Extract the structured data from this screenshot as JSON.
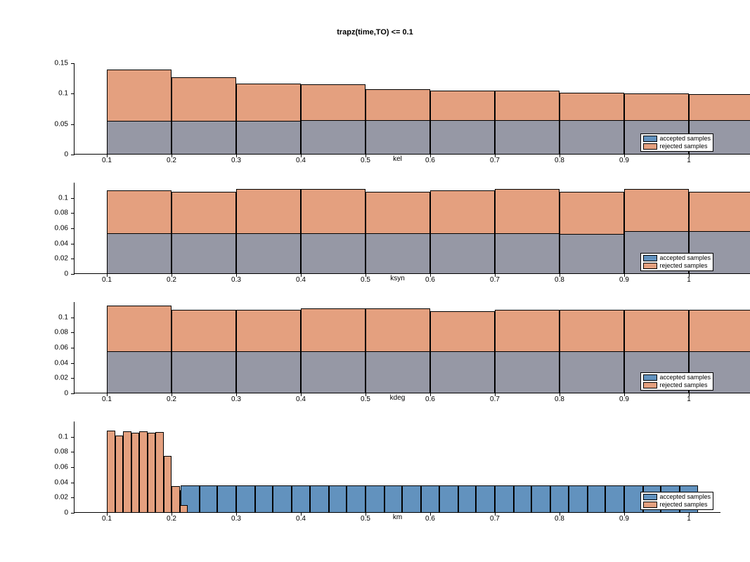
{
  "title": "trapz(time,TO) <= 0.1",
  "legend": {
    "accepted": "accepted samples",
    "rejected": "rejected samples"
  },
  "xticks": [
    0.1,
    0.2,
    0.3,
    0.4,
    0.5,
    0.6,
    0.7,
    0.8,
    0.9,
    1
  ],
  "panels": {
    "kel": {
      "xlabel": "kel",
      "ymax": 0.15,
      "yticks": [
        0,
        0.05,
        0.1,
        0.15
      ]
    },
    "ksyn": {
      "xlabel": "ksyn",
      "ymax": 0.12,
      "yticks": [
        0,
        0.02,
        0.04,
        0.06,
        0.08,
        0.1
      ]
    },
    "kdeg": {
      "xlabel": "kdeg",
      "ymax": 0.12,
      "yticks": [
        0,
        0.02,
        0.04,
        0.06,
        0.08,
        0.1
      ]
    },
    "km": {
      "xlabel": "km",
      "ymax": 0.12,
      "yticks": [
        0,
        0.02,
        0.04,
        0.06,
        0.08,
        0.1
      ]
    }
  },
  "chart_data": [
    {
      "type": "bar",
      "param": "kel",
      "title": "trapz(time,TO) <= 0.1",
      "xlabel": "kel",
      "ylabel": "",
      "ylim": [
        0,
        0.15
      ],
      "bin_edges": [
        0.1,
        0.2,
        0.3,
        0.4,
        0.5,
        0.6,
        0.7,
        0.8,
        0.9,
        1.0
      ],
      "series": [
        {
          "name": "accepted samples",
          "values": [
            0.14,
            0.127,
            0.117,
            0.115,
            0.107,
            0.105,
            0.105,
            0.102,
            0.1,
            0.099
          ]
        },
        {
          "name": "rejected samples",
          "values": [
            0.055,
            0.055,
            0.055,
            0.056,
            0.057,
            0.057,
            0.057,
            0.056,
            0.056,
            0.056
          ]
        }
      ]
    },
    {
      "type": "bar",
      "param": "ksyn",
      "xlabel": "ksyn",
      "ylim": [
        0,
        0.12
      ],
      "bin_edges": [
        0.1,
        0.2,
        0.3,
        0.4,
        0.5,
        0.6,
        0.7,
        0.8,
        0.9,
        1.0
      ],
      "series": [
        {
          "name": "accepted samples",
          "values": [
            0.11,
            0.108,
            0.112,
            0.112,
            0.108,
            0.11,
            0.112,
            0.108,
            0.112,
            0.108
          ]
        },
        {
          "name": "rejected samples",
          "values": [
            0.054,
            0.054,
            0.054,
            0.054,
            0.054,
            0.054,
            0.054,
            0.053,
            0.056,
            0.056
          ]
        }
      ]
    },
    {
      "type": "bar",
      "param": "kdeg",
      "xlabel": "kdeg",
      "ylim": [
        0,
        0.12
      ],
      "bin_edges": [
        0.1,
        0.2,
        0.3,
        0.4,
        0.5,
        0.6,
        0.7,
        0.8,
        0.9,
        1.0
      ],
      "series": [
        {
          "name": "accepted samples",
          "values": [
            0.115,
            0.11,
            0.11,
            0.112,
            0.112,
            0.108,
            0.11,
            0.11,
            0.11,
            0.11
          ]
        },
        {
          "name": "rejected samples",
          "values": [
            0.055,
            0.055,
            0.055,
            0.055,
            0.055,
            0.055,
            0.055,
            0.055,
            0.055,
            0.055
          ]
        }
      ]
    },
    {
      "type": "bar",
      "param": "km",
      "xlabel": "km",
      "ylim": [
        0,
        0.12
      ],
      "bin_edges_accepted": [
        0.1,
        0.129,
        0.157,
        0.186,
        0.214,
        0.243,
        0.271,
        0.3,
        0.329,
        0.357,
        0.386,
        0.414,
        0.443,
        0.471,
        0.5,
        0.529,
        0.557,
        0.586,
        0.614,
        0.643,
        0.671,
        0.7,
        0.729,
        0.757,
        0.786,
        0.814,
        0.843,
        0.871,
        0.9,
        0.929,
        0.957,
        0.986,
        1.014
      ],
      "bin_edges_rejected": [
        0.1,
        0.113,
        0.125,
        0.138,
        0.15,
        0.163,
        0.175,
        0.188,
        0.2,
        0.213,
        0.225
      ],
      "series": [
        {
          "name": "accepted samples",
          "values": [
            0,
            0,
            0,
            0.03,
            0.036,
            0.036,
            0.036,
            0.036,
            0.036,
            0.036,
            0.036,
            0.036,
            0.036,
            0.036,
            0.036,
            0.036,
            0.036,
            0.036,
            0.036,
            0.036,
            0.036,
            0.036,
            0.036,
            0.036,
            0.036,
            0.036,
            0.036,
            0.036,
            0.036,
            0.036,
            0.036,
            0.036
          ]
        },
        {
          "name": "rejected samples",
          "values": [
            0.108,
            0.102,
            0.107,
            0.105,
            0.107,
            0.105,
            0.106,
            0.075,
            0.035,
            0.01
          ]
        }
      ]
    }
  ]
}
